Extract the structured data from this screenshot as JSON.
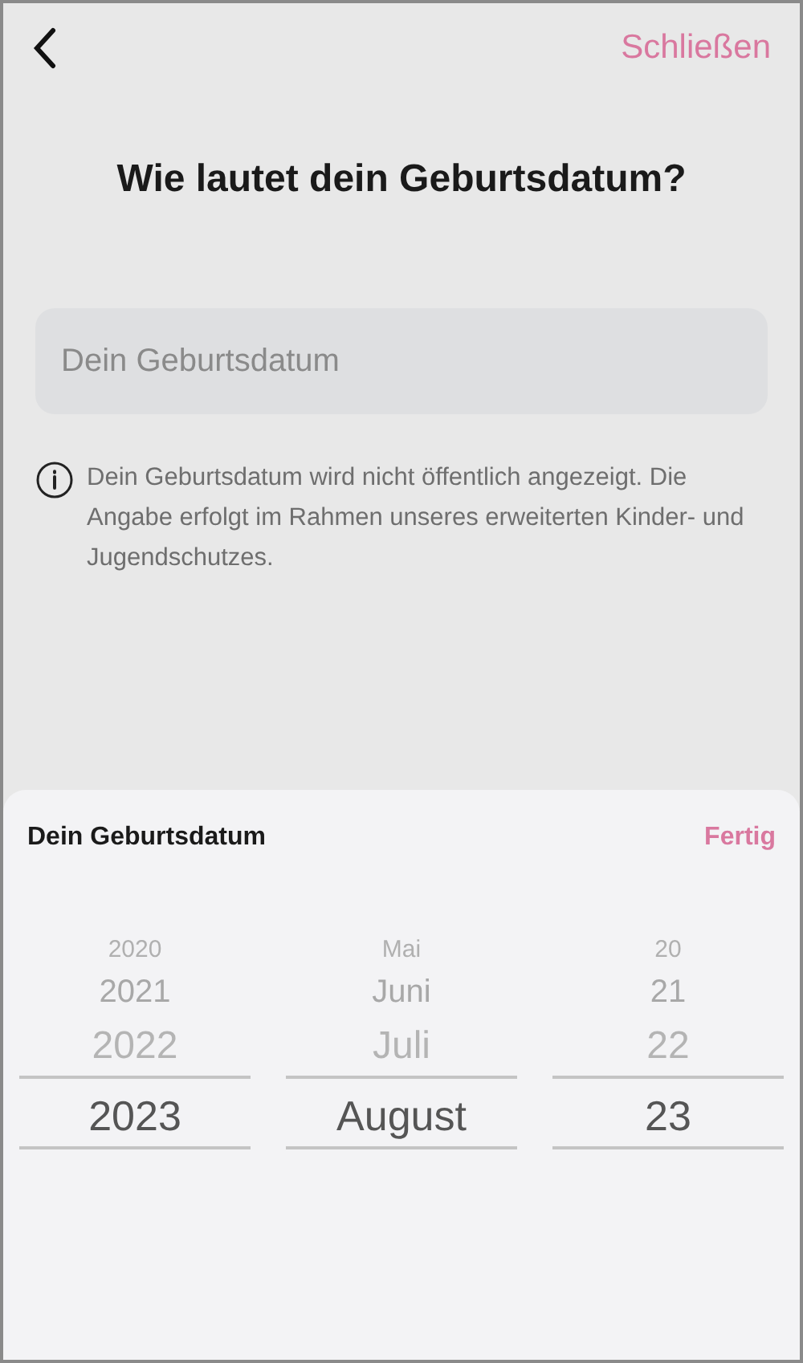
{
  "header": {
    "close": "Schließen"
  },
  "title": "Wie lautet dein Geburtsdatum?",
  "field": {
    "placeholder": "Dein Geburtsdatum"
  },
  "info": "Dein Geburtsdatum wird nicht öffentlich angezeigt. Die Angabe erfolgt im Rahmen unseres erweiterten Kinder- und Jugendschutzes.",
  "sheet": {
    "title": "Dein Geburtsdatum",
    "done": "Fertig",
    "columns": [
      {
        "items": [
          {
            "label": "2020",
            "selected": false
          },
          {
            "label": "2021",
            "selected": false
          },
          {
            "label": "2022",
            "selected": false
          },
          {
            "label": "2023",
            "selected": true
          }
        ]
      },
      {
        "items": [
          {
            "label": "Mai",
            "selected": false
          },
          {
            "label": "Juni",
            "selected": false
          },
          {
            "label": "Juli",
            "selected": false
          },
          {
            "label": "August",
            "selected": true
          }
        ]
      },
      {
        "items": [
          {
            "label": "20",
            "selected": false
          },
          {
            "label": "21",
            "selected": false
          },
          {
            "label": "22",
            "selected": false
          },
          {
            "label": "23",
            "selected": true
          }
        ]
      }
    ]
  }
}
